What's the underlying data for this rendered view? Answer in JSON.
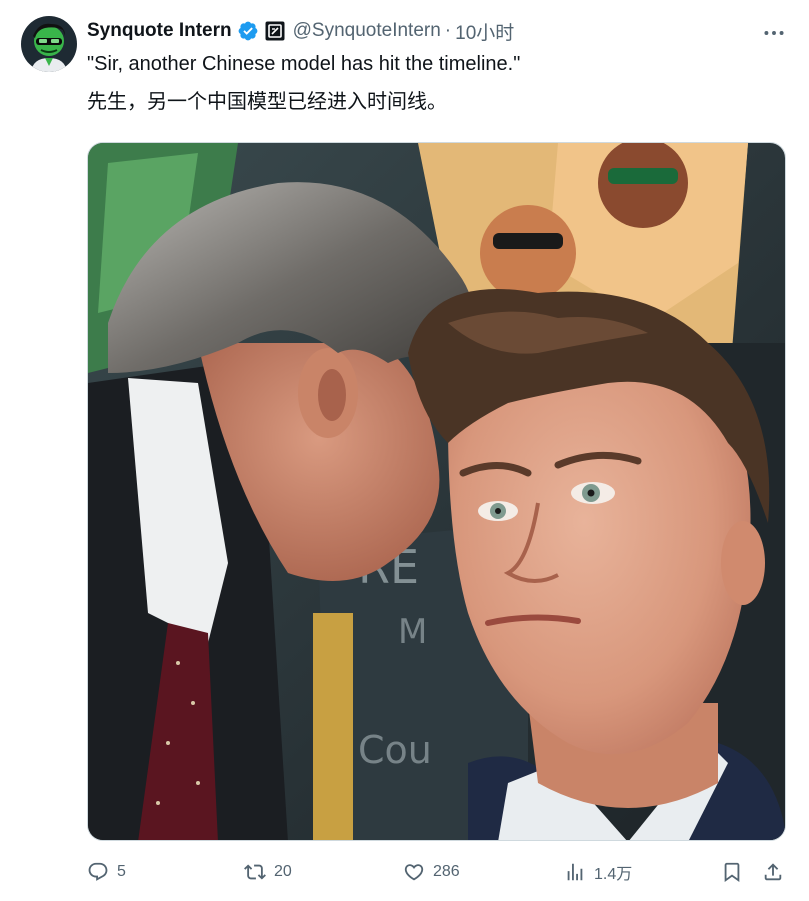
{
  "author": {
    "display_name": "Synquote Intern",
    "handle": "@SynquoteIntern",
    "separator": "·",
    "time": "10小时",
    "avatar_icon": "green-mask-avatar",
    "verified_icon": "verified-badge-icon",
    "affiliation_icon": "synquote-logo-icon"
  },
  "tweet": {
    "text_en": "\"Sir, another Chinese model has hit the timeline.\"",
    "text_zh": "先生，另一个中国模型已经进入时间线。"
  },
  "actions": {
    "replies": "5",
    "reposts": "20",
    "likes": "286",
    "views": "1.4万"
  },
  "colors": {
    "text": "#0f1419",
    "secondary": "#536471",
    "verified_blue": "#1d9bf0",
    "border": "#cfd9de"
  }
}
